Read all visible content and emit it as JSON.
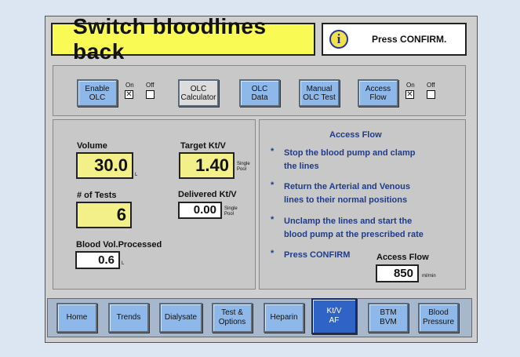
{
  "header": {
    "title": "Switch bloodlines back",
    "info_icon": "info-icon",
    "info_glyph": "i",
    "message": "Press CONFIRM."
  },
  "olc_controls": {
    "enable_olc": "Enable\nOLC",
    "enable_on_label": "On",
    "enable_off_label": "Off",
    "enable_state": "on",
    "olc_calculator": "OLC\nCalculator",
    "olc_data": "OLC\nData",
    "manual_olc_test": "Manual\nOLC Test",
    "access_flow": "Access\nFlow",
    "access_on_label": "On",
    "access_off_label": "Off",
    "access_state": "on"
  },
  "left": {
    "volume_label": "Volume",
    "volume_value": "30.0",
    "volume_unit": "L",
    "tests_label": "# of Tests",
    "tests_value": "6",
    "blood_vol_label": "Blood Vol.Processed",
    "blood_vol_value": "0.6",
    "blood_vol_unit": "L",
    "target_label": "Target Kt/V",
    "target_value": "1.40",
    "target_unit": "Single\nPool",
    "delivered_label": "Delivered Kt/V",
    "delivered_value": "0.00",
    "delivered_unit": "Single\nPool"
  },
  "access_flow_panel": {
    "title": "Access Flow",
    "bullet": "*",
    "steps": [
      "Stop the blood pump and clamp\nthe lines",
      "Return the Arterial and Venous\nlines to their normal positions",
      "Unclamp the lines and start the\nblood pump at the prescribed rate",
      "Press CONFIRM"
    ],
    "value_label": "Access Flow",
    "value": "850",
    "unit": "ml/min"
  },
  "tabs": [
    {
      "label": "Home"
    },
    {
      "label": "Trends"
    },
    {
      "label": "Dialysate"
    },
    {
      "label": "Test &\nOptions"
    },
    {
      "label": "Heparin"
    },
    {
      "label": "Kt/V\nAF",
      "active": true
    },
    {
      "label": "BTM\nBVM"
    },
    {
      "label": "Blood\nPressure"
    }
  ],
  "colors": {
    "title_bg": "#fafa55",
    "button_blue": "#8fb8ea",
    "active_tab": "#2f64c6",
    "instruction_text": "#1f3c8a",
    "value_yellow": "#f3f08a"
  }
}
